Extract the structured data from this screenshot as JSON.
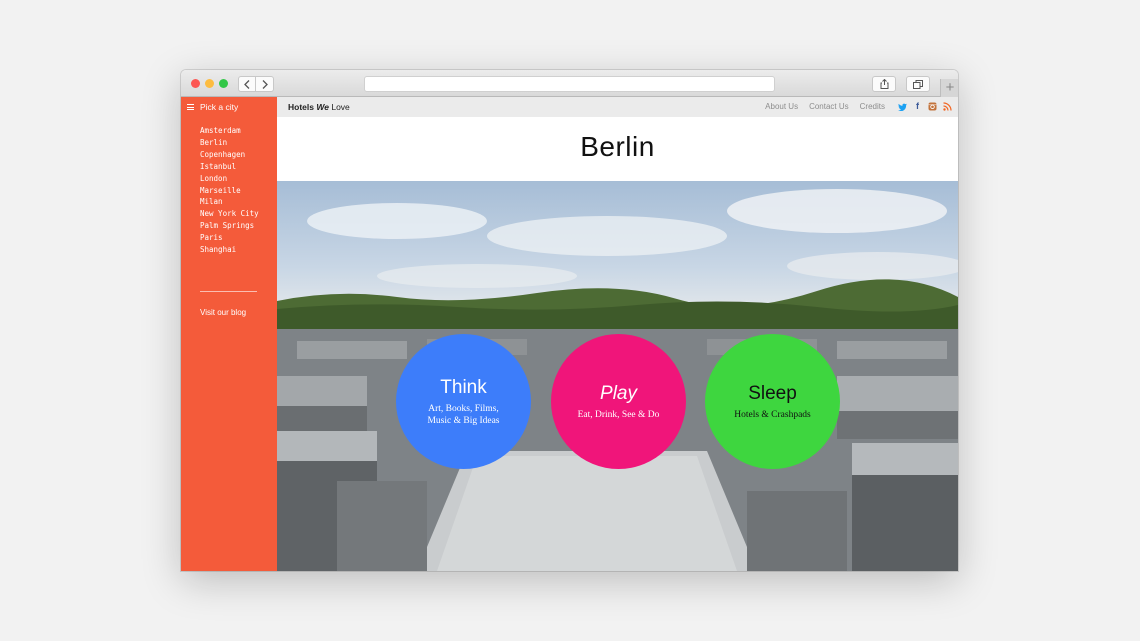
{
  "sidebar": {
    "menu_label": "Pick a city",
    "cities": [
      "Amsterdam",
      "Berlin",
      "Copenhagen",
      "Istanbul",
      "London",
      "Marseille",
      "Milan",
      "New York City",
      "Palm Springs",
      "Paris",
      "Shanghai"
    ],
    "blog_link": "Visit our blog"
  },
  "brand": {
    "part1": "Hotels",
    "part2": "We",
    "part3": "Love"
  },
  "nav": {
    "about": "About Us",
    "contact": "Contact Us",
    "credits": "Credits"
  },
  "header": {
    "city": "Berlin"
  },
  "sections": {
    "think": {
      "title": "Think",
      "line1": "Art, Books, Films,",
      "line2": "Music & Big Ideas"
    },
    "play": {
      "title": "Play",
      "line1": "Eat, Drink, See & Do"
    },
    "sleep": {
      "title": "Sleep",
      "line1": "Hotels & Crashpads"
    }
  },
  "colors": {
    "sidebar": "#f45b3a",
    "think": "#3d7dfa",
    "play": "#f0157a",
    "sleep": "#3ed63f",
    "twitter": "#1da1f2",
    "facebook": "#3b5998",
    "instagram": "#c2733c",
    "rss": "#f26522"
  },
  "icons": [
    "menu-icon",
    "twitter-icon",
    "facebook-icon",
    "instagram-icon",
    "rss-icon",
    "back-icon",
    "forward-icon",
    "share-icon",
    "tabs-icon",
    "new-tab-icon"
  ]
}
